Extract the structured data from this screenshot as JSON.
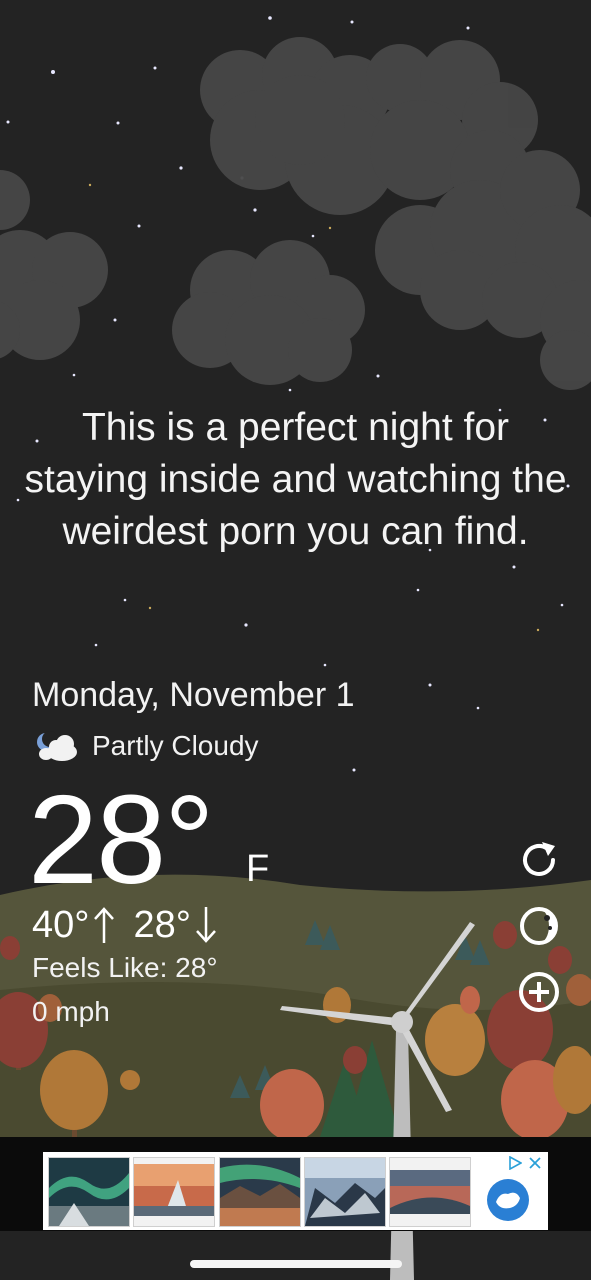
{
  "message": "This is a perfect night for staying inside and watching the weirdest porn you can find.",
  "date": "Monday, November 1",
  "condition": {
    "icon": "partly-cloudy-night-icon",
    "text": "Partly Cloudy"
  },
  "temperature": {
    "value": "28°",
    "unit": "F"
  },
  "high": "40°",
  "low": "28°",
  "feels_like": "Feels Like: 28°",
  "wind": "0 mph",
  "controls": [
    "refresh-icon",
    "theme-toggle-icon",
    "add-location-icon"
  ],
  "colors": {
    "sky": "#232323",
    "cloud": "#4a4a4a",
    "ground": "#4b4b33",
    "text": "#ffffff"
  }
}
